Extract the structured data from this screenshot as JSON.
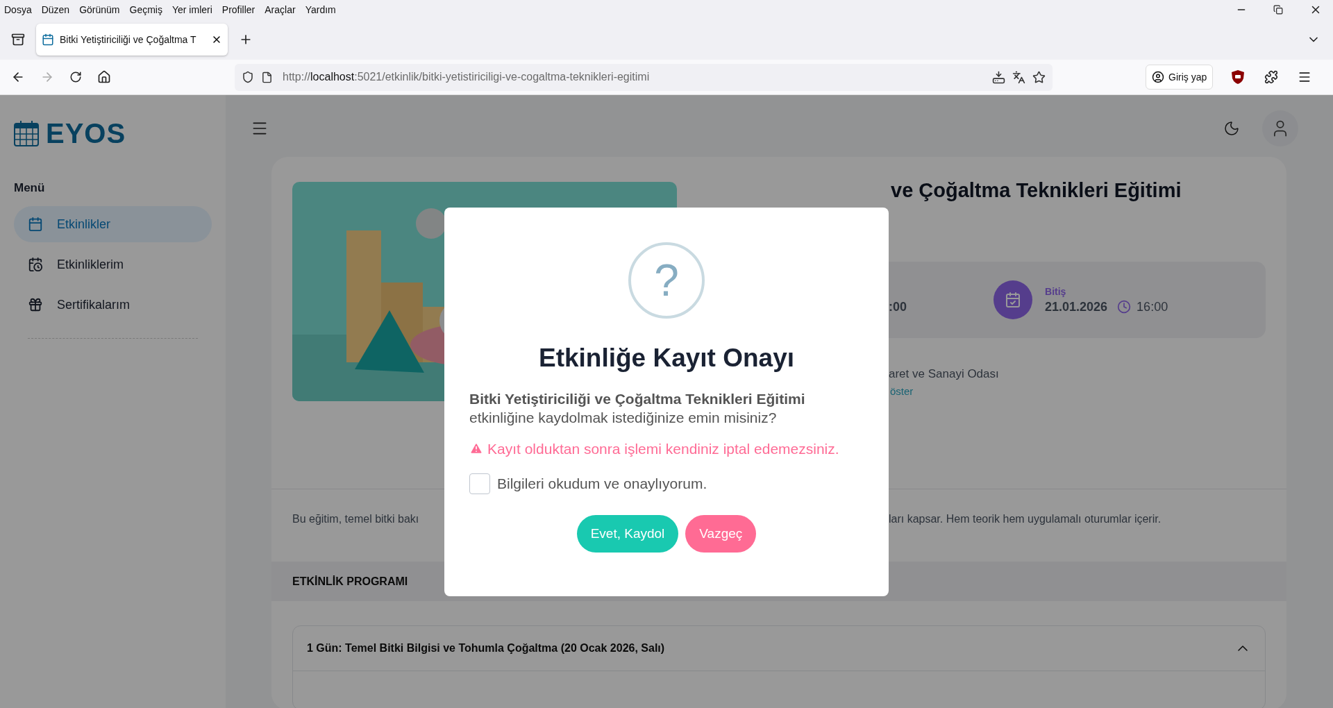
{
  "browser": {
    "menu_items": [
      "Dosya",
      "Düzen",
      "Görünüm",
      "Geçmiş",
      "Yer imleri",
      "Profiller",
      "Araçlar",
      "Yardım"
    ],
    "tab": {
      "title": "Bitki Yetiştiriciliği ve Çoğaltma T"
    },
    "url": {
      "scheme": "http://",
      "host": "localhost",
      "path": ":5021/etkinlik/bitki-yetistiriciligi-ve-cogaltma-teknikleri-egitimi"
    },
    "profile_button": "Giriş yap"
  },
  "sidebar": {
    "logo": "EYOS",
    "menu_title": "Menü",
    "items": [
      {
        "label": "Etkinlikler",
        "selected": true,
        "kind": "calendar"
      },
      {
        "label": "Etkinliklerim",
        "selected": false,
        "kind": "my-calendar"
      },
      {
        "label": "Sertifikalarım",
        "selected": false,
        "kind": "certificate"
      }
    ]
  },
  "event": {
    "title_fragment": "ve Çoğaltma Teknikleri Eğitimi",
    "start_time_fragment": ":00",
    "end": {
      "label": "Bitiş",
      "date": "21.01.2026",
      "time": "16:00"
    },
    "organizer_fragment": "aret ve Sanayi Odası",
    "link_fragment": "öster",
    "description_fragments": [
      "Bu eğitim, temel bitki bakı",
      "ları kapsar. Hem teorik hem uygulamalı oturumlar içerir."
    ],
    "program_title": "ETKİNLİK PROGRAMI",
    "program_days": [
      {
        "title": "1 Gün: Temel Bitki Bilgisi ve Tohumla Çoğaltma (20 Ocak 2026, Salı)",
        "expanded": true
      }
    ]
  },
  "modal": {
    "icon": "?",
    "title": "Etkinliğe Kayıt Onayı",
    "event_name": "Bitki Yetiştiriciliği ve Çoğaltma Teknikleri Eğitimi",
    "question": "etkinliğine kaydolmak istediğinize emin misiniz?",
    "warning": "Kayıt olduktan sonra işlemi kendiniz iptal edemezsiniz.",
    "checkbox": {
      "label": "Bilgileri okudum ve onaylıyorum.",
      "checked": false
    },
    "buttons": [
      {
        "label": "Evet, Kaydol",
        "kind": "confirm"
      },
      {
        "label": "Vazgeç",
        "kind": "cancel"
      }
    ]
  }
}
